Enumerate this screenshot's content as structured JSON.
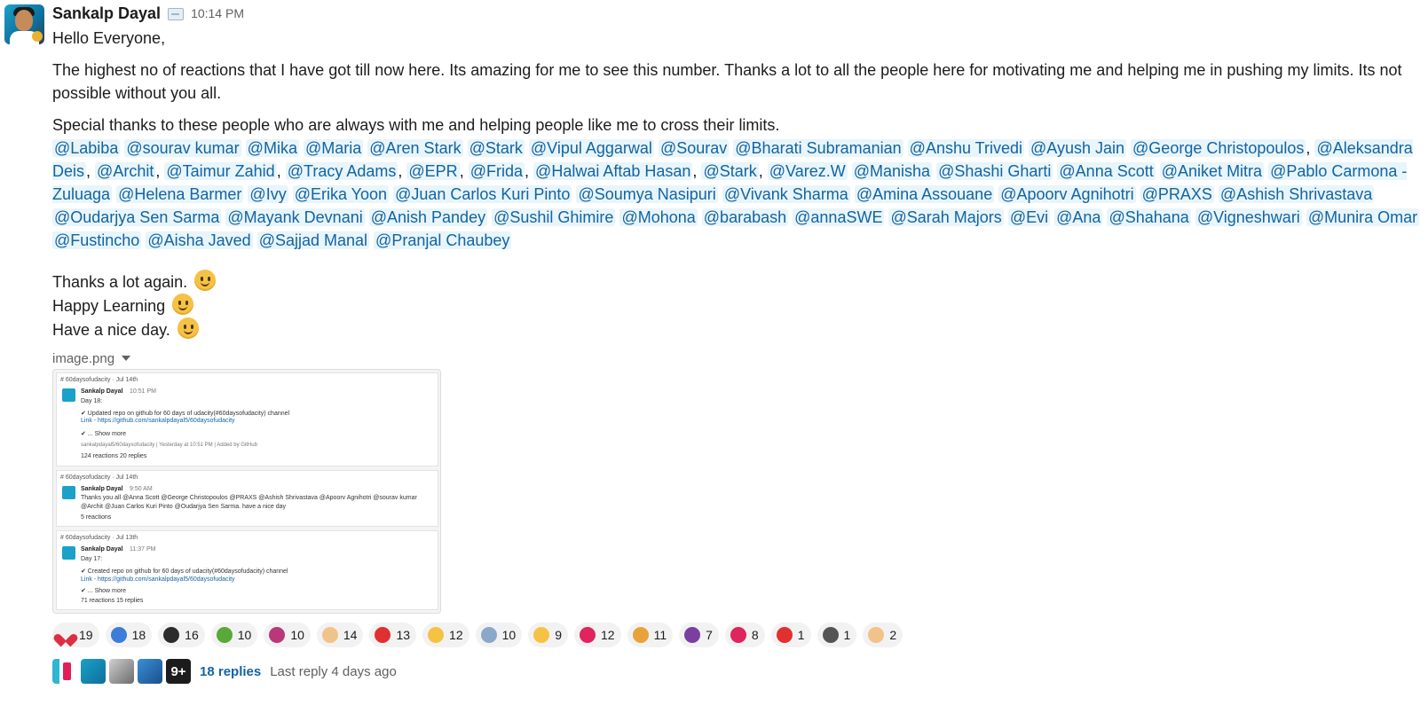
{
  "message": {
    "author": "Sankalp Dayal",
    "time": "10:14 PM",
    "greeting": "Hello Everyone,",
    "paragraph1": "The highest no of reactions that I have got till now here. Its amazing for me to see this number. Thanks a lot to all the people here for motivating me and helping me in pushing my limits. Its not possible without you all.",
    "paragraph2": "Special thanks to these people who are always with me and helping people like me to cross their limits.",
    "mentions": [
      {
        "name": "@Labiba",
        "sep": ""
      },
      {
        "name": "@sourav kumar",
        "sep": ""
      },
      {
        "name": "@Mika",
        "sep": ""
      },
      {
        "name": "@Maria",
        "sep": ""
      },
      {
        "name": "@Aren Stark",
        "sep": ""
      },
      {
        "name": "@Stark",
        "sep": ""
      },
      {
        "name": "@Vipul Aggarwal",
        "sep": ""
      },
      {
        "name": "@Sourav",
        "sep": ""
      },
      {
        "name": "@Bharati Subramanian",
        "sep": ""
      },
      {
        "name": "@Anshu Trivedi",
        "sep": ""
      },
      {
        "name": "@Ayush Jain",
        "sep": ""
      },
      {
        "name": "@George Christopoulos",
        "sep": ","
      },
      {
        "name": "@Aleksandra Deis",
        "sep": ","
      },
      {
        "name": "@Archit",
        "sep": ","
      },
      {
        "name": "@Taimur Zahid",
        "sep": ","
      },
      {
        "name": "@Tracy Adams",
        "sep": ","
      },
      {
        "name": "@EPR",
        "sep": ","
      },
      {
        "name": "@Frida",
        "sep": ","
      },
      {
        "name": "@Halwai Aftab Hasan",
        "sep": ","
      },
      {
        "name": "@Stark",
        "sep": ","
      },
      {
        "name": "@Varez.W",
        "sep": ""
      },
      {
        "name": "@Manisha",
        "sep": ""
      },
      {
        "name": "@Shashi Gharti",
        "sep": ""
      },
      {
        "name": "@Anna Scott",
        "sep": ""
      },
      {
        "name": "@Aniket Mitra",
        "sep": ""
      },
      {
        "name": "@Pablo Carmona - Zuluaga",
        "sep": ""
      },
      {
        "name": "@Helena Barmer",
        "sep": ""
      },
      {
        "name": "@Ivy",
        "sep": ""
      },
      {
        "name": "@Erika Yoon",
        "sep": ""
      },
      {
        "name": "@Juan Carlos Kuri Pinto",
        "sep": ""
      },
      {
        "name": "@Soumya Nasipuri",
        "sep": ""
      },
      {
        "name": "@Vivank Sharma",
        "sep": ""
      },
      {
        "name": "@Amina Assouane",
        "sep": ""
      },
      {
        "name": "@Apoorv Agnihotri",
        "sep": ""
      },
      {
        "name": "@PRAXS",
        "sep": ""
      },
      {
        "name": "@Ashish Shrivastava",
        "sep": ""
      },
      {
        "name": "@Oudarjya Sen Sarma",
        "sep": ""
      },
      {
        "name": "@Mayank Devnani",
        "sep": ""
      },
      {
        "name": "@Anish Pandey",
        "sep": ""
      },
      {
        "name": "@Sushil Ghimire",
        "sep": ""
      },
      {
        "name": "@Mohona",
        "sep": ""
      },
      {
        "name": "@barabash",
        "sep": ""
      },
      {
        "name": "@annaSWE",
        "sep": ""
      },
      {
        "name": "@Sarah Majors",
        "sep": ""
      },
      {
        "name": "@Evi",
        "sep": ""
      },
      {
        "name": "@Ana",
        "sep": ""
      },
      {
        "name": "@Shahana",
        "sep": ""
      },
      {
        "name": "@Vigneshwari",
        "sep": ""
      },
      {
        "name": "@Munira Omar",
        "sep": ""
      },
      {
        "name": "@Fustincho",
        "sep": ""
      },
      {
        "name": "@Aisha Javed",
        "sep": ""
      },
      {
        "name": "@Sajjad Manal",
        "sep": ""
      },
      {
        "name": "@Pranjal Chaubey",
        "sep": ""
      }
    ],
    "closing": [
      "Thanks a lot again.",
      "Happy Learning",
      "Have a nice day."
    ]
  },
  "attachment": {
    "filename": "image.png",
    "preview": [
      {
        "channel": "# 60daysofudacity  ·  Jul 14th",
        "author": "Sankalp Dayal",
        "time": "10:51 PM",
        "lines": [
          "Day 18:",
          "✔ Updated repo on github for 60 days of udacity(#60daysofudacity) channel",
          "Link - https://github.com/sankalpdayal5/60daysofudacity",
          "✔ ... Show more",
          "sankalpdayal5/60daysofudacity | Yesterday at 10:51 PM | Added by GitHub",
          "124 reactions     20 replies"
        ]
      },
      {
        "channel": "# 60daysofudacity  ·  Jul 14th",
        "author": "Sankalp Dayal",
        "time": "9:50 AM",
        "lines": [
          "Thanks you all @Anna Scott @George Christopoulos @PRAXS @Ashish Shrivastava @Apoorv Agnihotri @sourav kumar",
          "@Archit @Juan Carlos Kuri Pinto @Oudarjya Sen Sarma. have a nice day",
          "5 reactions"
        ]
      },
      {
        "channel": "# 60daysofudacity  ·  Jul 13th",
        "author": "Sankalp Dayal",
        "time": "11:37 PM",
        "lines": [
          "Day 17:",
          "✔ Created repo on github for 60 days of udacity(#60daysofudacity) channel",
          "Link - https://github.com/sankalpdayal5/60daysofudacity",
          "✔ ... Show more",
          "71 reactions     15 replies"
        ]
      }
    ]
  },
  "reactions": [
    {
      "icon": "heart-icon",
      "count": "19",
      "color": "#dd2e44"
    },
    {
      "icon": "thank-you-icon",
      "count": "18",
      "color": "#3b7dd8"
    },
    {
      "icon": "parrot-icon",
      "count": "16",
      "color": "#2c2c2c"
    },
    {
      "icon": "dancing-figure-icon",
      "count": "10",
      "color": "#58a83a"
    },
    {
      "icon": "party-parrot-icon",
      "count": "10",
      "color": "#b8387a"
    },
    {
      "icon": "clap-icon",
      "count": "14",
      "color": "#f2c28b"
    },
    {
      "icon": "hundred-icon",
      "count": "13",
      "color": "#e03030"
    },
    {
      "icon": "thumbs-up-icon",
      "count": "12",
      "color": "#f6c244"
    },
    {
      "icon": "rocket-icon",
      "count": "10",
      "color": "#8aa8c8"
    },
    {
      "icon": "muscle-icon",
      "count": "9",
      "color": "#f6c244"
    },
    {
      "icon": "target-icon",
      "count": "12",
      "color": "#e0245e"
    },
    {
      "icon": "tada-icon",
      "count": "11",
      "color": "#e8a23a"
    },
    {
      "icon": "badge-icon",
      "count": "7",
      "color": "#7b3fa0"
    },
    {
      "icon": "fire-heart-icon",
      "count": "8",
      "color": "#e0245e"
    },
    {
      "icon": "hundred-icon",
      "count": "1",
      "color": "#e03030"
    },
    {
      "icon": "dab-icon",
      "count": "1",
      "color": "#555555"
    },
    {
      "icon": "raised-hands-icon",
      "count": "2",
      "color": "#f2c28b"
    }
  ],
  "thread": {
    "overflow_badge": "9+",
    "replies": "18 replies",
    "last_reply": "Last reply 4 days ago"
  }
}
